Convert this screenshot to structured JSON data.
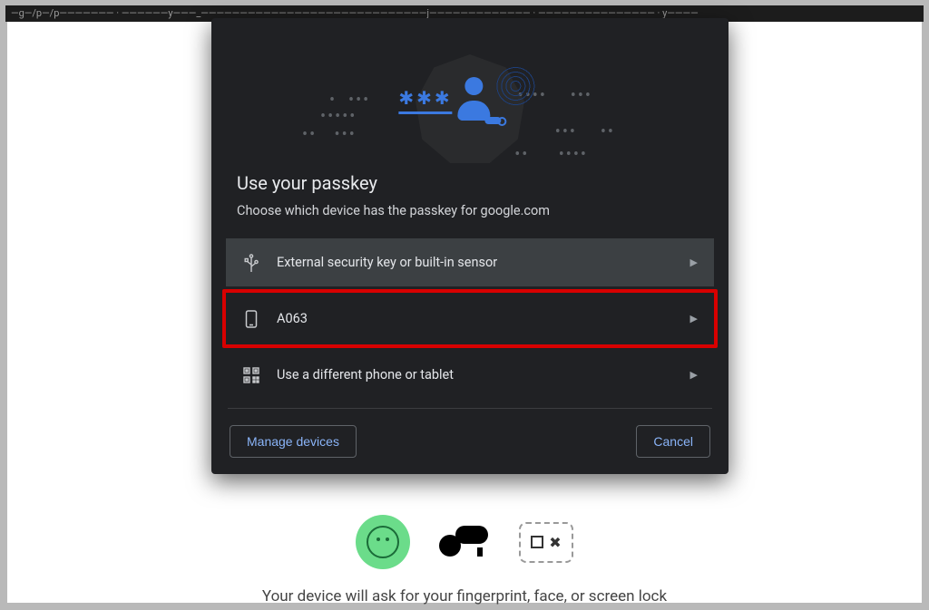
{
  "addressbar_text": "—g—/p—/p——————— · ——————y———_—————————————————————————————j————————————— · ——————————————— · y————",
  "dialog": {
    "title": "Use your passkey",
    "subtitle": "Choose which device has the passkey for google.com",
    "options": [
      {
        "label": "External security key or built-in sensor",
        "icon": "usb-icon"
      },
      {
        "label": "A063",
        "icon": "phone-icon"
      },
      {
        "label": "Use a different phone or tablet",
        "icon": "qr-icon"
      }
    ],
    "manage_label": "Manage devices",
    "cancel_label": "Cancel"
  },
  "background": {
    "caption": "Your device will ask for your fingerprint, face, or screen lock"
  }
}
